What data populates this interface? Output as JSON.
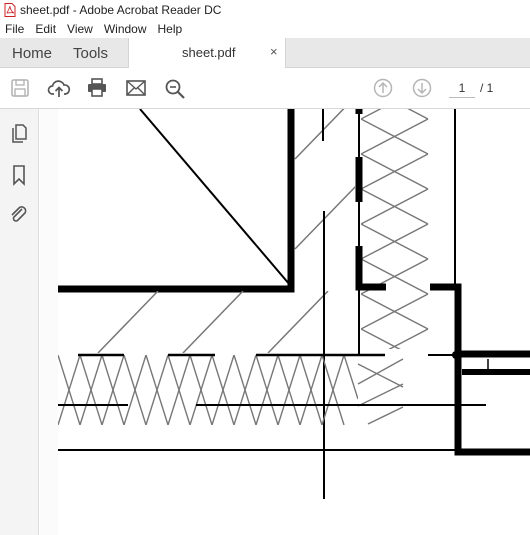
{
  "window": {
    "title": "sheet.pdf - Adobe Acrobat Reader DC"
  },
  "menu": {
    "items": [
      "File",
      "Edit",
      "View",
      "Window",
      "Help"
    ]
  },
  "tabs": {
    "home": "Home",
    "tools": "Tools",
    "document": "sheet.pdf",
    "close_glyph": "×"
  },
  "toolbar": {
    "icons": [
      "save-icon",
      "upload-cloud-icon",
      "print-icon",
      "email-icon",
      "zoom-out-icon",
      "page-up-icon",
      "page-down-icon"
    ],
    "current_page": "1",
    "total_pages": "/ 1"
  },
  "sidebar": {
    "icons": [
      "page-thumbnails-icon",
      "bookmark-icon",
      "attachment-icon"
    ]
  },
  "colors": {
    "tab_bar": "#e8e8e8",
    "sidebar": "#f4f4f4",
    "drawing_line": "#000000",
    "hatch": "#7a7a7a"
  }
}
